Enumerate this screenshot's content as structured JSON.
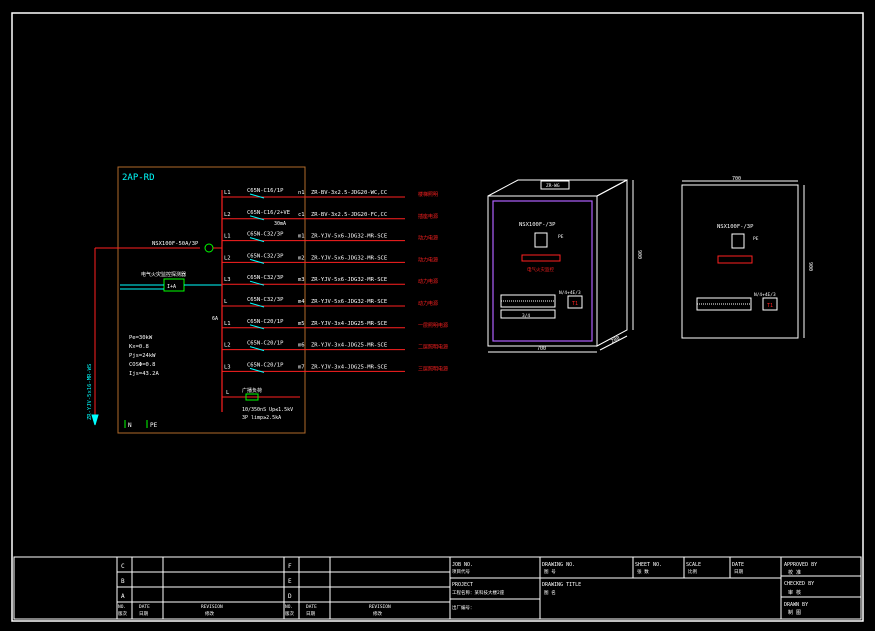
{
  "panel": {
    "name": "2AP-RD",
    "main_breaker": "NSX100F-50A/3P",
    "meter_label": "电气火灾监控探测器",
    "meter_box": "I+A",
    "ct_label": "6A",
    "load": {
      "pe": "Pe=30kW",
      "kx": "Kx=0.8",
      "pjs": "Pjs=24kW",
      "cos": "COSΦ=0.8",
      "ijs": "Ijs=43.2A"
    },
    "feeder_vertical": "ZR-YJV-5x16-MR-WS",
    "footer": {
      "n": "N",
      "pe": "PE"
    }
  },
  "circuits": [
    {
      "phase": "L1",
      "breaker": "C65N-C16/1P",
      "extra": "",
      "no": "n1",
      "cable": "ZR-BV-3x2.5-JDG20-WC,CC",
      "desc": "楼梯照明"
    },
    {
      "phase": "L2",
      "breaker": "C65N-C16/2+VE",
      "extra": "30mA",
      "no": "c1",
      "cable": "ZR-BV-3x2.5-JDG20-FC,CC",
      "desc": "插座电源"
    },
    {
      "phase": "L1",
      "breaker": "C65N-C32/3P",
      "extra": "",
      "no": "m1",
      "cable": "ZR-YJV-5x6-JDG32-MR-SCE",
      "desc": "动力电源"
    },
    {
      "phase": "L2",
      "breaker": "C65N-C32/3P",
      "extra": "",
      "no": "m2",
      "cable": "ZR-YJV-5x6-JDG32-MR-SCE",
      "desc": "动力电源"
    },
    {
      "phase": "L3",
      "breaker": "C65N-C32/3P",
      "extra": "",
      "no": "m3",
      "cable": "ZR-YJV-5x6-JDG32-MR-SCE",
      "desc": "动力电源"
    },
    {
      "phase": "L",
      "breaker": "C65N-C32/3P",
      "extra": "",
      "no": "m4",
      "cable": "ZR-YJV-5x6-JDG32-MR-SCE",
      "desc": "动力电源"
    },
    {
      "phase": "L1",
      "breaker": "C65N-C20/1P",
      "extra": "",
      "no": "m5",
      "cable": "ZR-YJV-3x4-JDG25-MR-SCE",
      "desc": "一层照明电源"
    },
    {
      "phase": "L2",
      "breaker": "C65N-C20/1P",
      "extra": "",
      "no": "m6",
      "cable": "ZR-YJV-3x4-JDG25-MR-SCE",
      "desc": "二层照明电源"
    },
    {
      "phase": "L3",
      "breaker": "C65N-C20/1P",
      "extra": "",
      "no": "m7",
      "cable": "ZR-YJV-3x4-JDG25-MR-SCE",
      "desc": "三层照明电源"
    }
  ],
  "spd": {
    "phase": "L",
    "label": "广播负荷",
    "spec1": "10/350nS Up≤1.5kV",
    "spec2": "3P  limp≥2.5kA"
  },
  "cabinet_iso": {
    "top_label": "ZR-WG",
    "breaker": "NSX100F-/3P",
    "spd_label": "PE",
    "warning": "电气火灾监控",
    "dim_width": "700",
    "dim_height": "900",
    "dim_depth": "200",
    "row_label": "3/4",
    "rail_label": "N/4+4E/3",
    "rail_code": "T1"
  },
  "cabinet_front": {
    "dim_width": "700",
    "dim_height": "900",
    "breaker": "NSX100F-/3P",
    "spd_label": "PE",
    "rail_label": "N/4+4E/3",
    "rail_code": "T1"
  },
  "title_block": {
    "rev_rows": [
      "C",
      "B",
      "A"
    ],
    "rev_rows2": [
      "F",
      "E",
      "D"
    ],
    "no_en": "NO.",
    "no_cn": "版次",
    "date_en": "DATE",
    "date_cn": "日期",
    "rev_en": "REVISION",
    "rev_cn": "修改",
    "job_en": "JOB NO.",
    "job_cn": "项目代号",
    "project_en": "PROJECT",
    "project_cn": "工程名称：某科技大楼2座",
    "owner_cn": "出厂编号：",
    "drawing_no_en": "DRAWING NO.",
    "drawing_no_cn": "图  号",
    "drawing_title_en": "DRAWING TITLE",
    "drawing_title_cn": "图  名",
    "sheet_en": "SHEET NO.",
    "sheet_cn": "张  数",
    "scale_en": "SCALE",
    "scale_cn": "比例",
    "date2_en": "DATE",
    "date2_cn": "日期",
    "approved_en": "APPROVED BY",
    "approved_cn": "校  准",
    "checked_en": "CHECKED BY",
    "checked_cn": "审  核",
    "drawn_en": "DRAWN BY",
    "drawn_cn": "制  图"
  }
}
